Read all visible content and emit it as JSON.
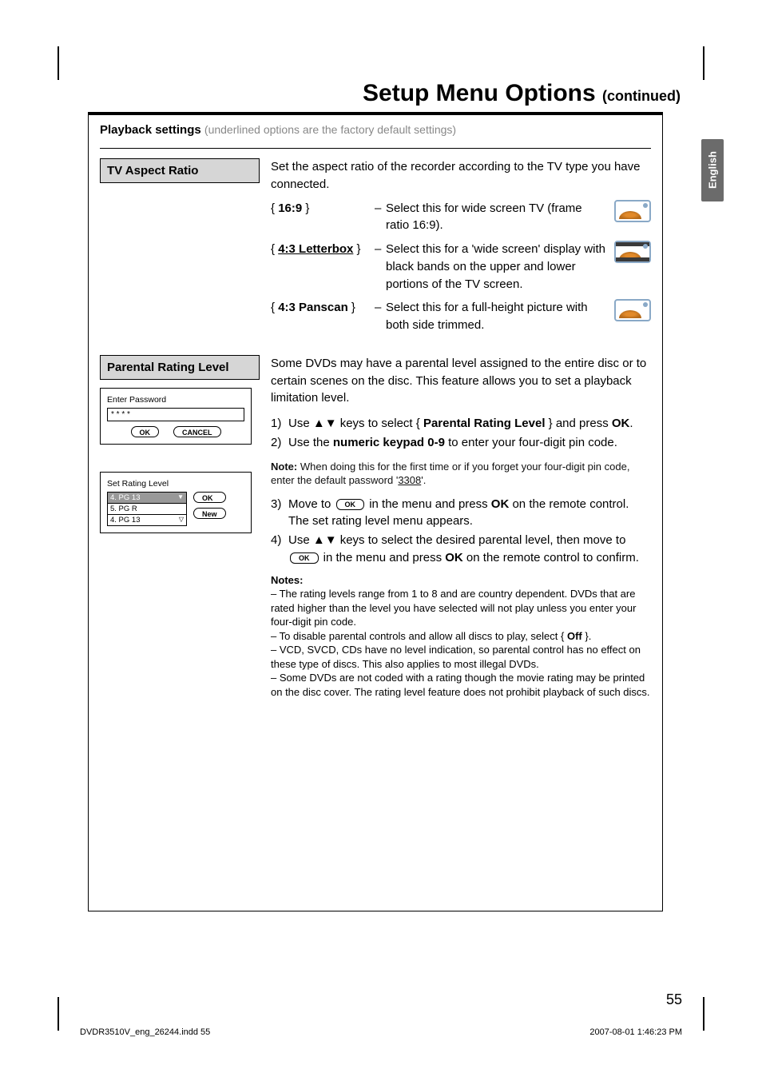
{
  "language_tab": "English",
  "chapter": {
    "title": "Setup Menu Options",
    "continued": "(continued)"
  },
  "playback_settings": {
    "title": "Playback settings",
    "note": "(underlined options are the factory default settings)"
  },
  "tv_aspect": {
    "heading": "TV Aspect Ratio",
    "intro": "Set the aspect ratio of the recorder according to the TV type you have connected.",
    "opt1_key": "16:9",
    "opt1_val": "Select this for wide screen TV (frame ratio 16:9).",
    "opt2_key": "4:3 Letterbox",
    "opt2_val": "Select this for a 'wide screen' display with black bands on the upper and lower portions of the TV screen.",
    "opt3_key": "4:3 Panscan",
    "opt3_val": "Select this for a full-height picture with both side trimmed."
  },
  "parental": {
    "heading": "Parental Rating Level",
    "intro": "Some DVDs may have a parental level assigned to the entire disc or to certain scenes on the disc. This feature allows you to set a playback limitation level.",
    "step1_a": "Use ",
    "step1_b": " keys to select { ",
    "step1_target": "Parental Rating Level",
    "step1_c": " } and press ",
    "step1_ok": "OK",
    "step1_d": ".",
    "step2_a": "Use the ",
    "step2_kp": "numeric keypad 0-9",
    "step2_b": " to enter your four-digit pin code.",
    "note_label": "Note:",
    "note_body": "When doing this for the first time or if you forget your four-digit pin code, enter the default password '",
    "note_pw_text": "3308",
    "note_tail": "'.",
    "step3_a": "Move to ",
    "step3_b": " in the menu and press ",
    "step3_ok": "OK",
    "step3_c": " on the remote control.  The set rating level menu appears.",
    "step4_a": "Use ",
    "step4_b": " keys to select the desired parental level, then move to ",
    "step4_c": " in the menu and press ",
    "step4_ok": "OK",
    "step4_d": " on the remote control to confirm.",
    "notes_heading": "Notes:",
    "notes_1": "The rating levels range from 1 to 8 and are country dependent. DVDs that are rated higher than the level you have selected will not play unless you enter your four-digit pin code.",
    "notes_2a": "To disable parental controls and allow all discs to play, select { ",
    "notes_2_off": "Off",
    "notes_2b": " }.",
    "notes_3": "VCD, SVCD, CDs have no level indication, so parental control has no effect on these type of discs. This also applies to most illegal DVDs.",
    "notes_4": "Some DVDs are not coded with a rating though the movie rating may be printed on the disc cover. The rating level feature does not prohibit playback of such discs."
  },
  "osd": {
    "enter_pw_title": "Enter Password",
    "stars": "* * * *",
    "ok": "OK",
    "cancel": "CANCEL",
    "set_rating_title": "Set Rating Level",
    "new": "New",
    "items": {
      "a": "4.  PG 13",
      "b": "5.  PG R",
      "c": "4.  PG 13"
    }
  },
  "ok_badge": "OK",
  "arrows": "▲▼",
  "page_number": "55",
  "footer": {
    "left": "DVDR3510V_eng_26244.indd   55",
    "right": "2007-08-01   1:46:23 PM"
  }
}
